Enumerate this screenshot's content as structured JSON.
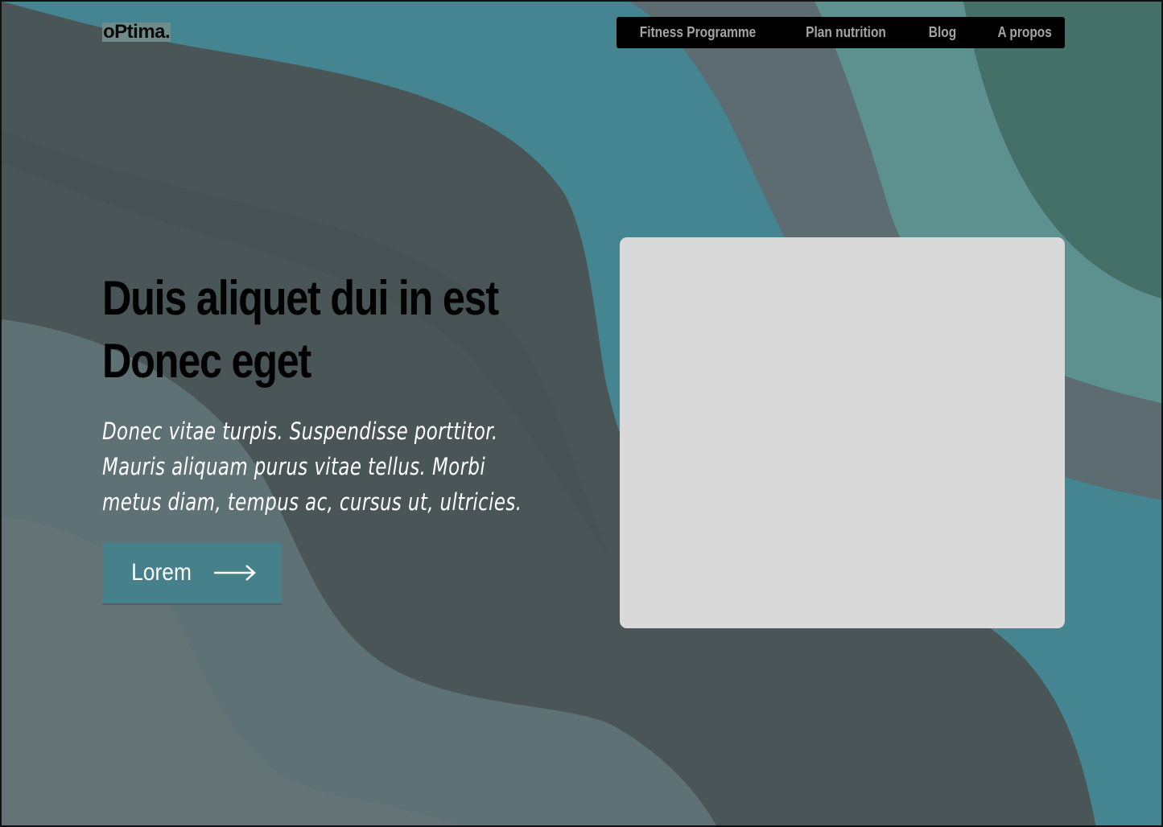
{
  "brand": {
    "logo_text": "oPtima."
  },
  "nav": {
    "items": [
      {
        "label": "Fitness Programme"
      },
      {
        "label": "Plan nutrition"
      },
      {
        "label": "Blog"
      },
      {
        "label": "A propos"
      }
    ]
  },
  "hero": {
    "headline_line1": "Duis aliquet dui in est",
    "headline_line2": "Donec eget",
    "subtitle_line1": "Donec vitae turpis. Suspendisse porttitor.",
    "subtitle_line2": "Mauris aliquam purus vitae tellus. Morbi",
    "subtitle_line3": "metus diam, tempus ac,  cursus ut, ultricies.",
    "cta_label": "Lorem",
    "cta_icon": "arrow-right-icon"
  },
  "colors": {
    "background_dark": "#4a5557",
    "accent_teal": "#46808a",
    "nav_bg": "#000000",
    "placeholder": "#d9d9d9"
  }
}
